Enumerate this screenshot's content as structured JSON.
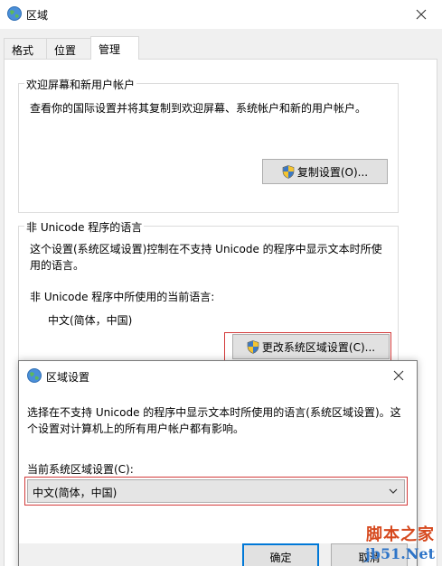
{
  "main_window": {
    "title": "区域",
    "tabs": [
      {
        "label": "格式"
      },
      {
        "label": "位置"
      },
      {
        "label": "管理"
      }
    ],
    "welcome_group": {
      "label": "欢迎屏幕和新用户帐户",
      "description": "查看你的国际设置并将其复制到欢迎屏幕、系统帐户和新的用户帐户。",
      "button_label": "复制设置(O)..."
    },
    "nonunicode_group": {
      "label": "非 Unicode 程序的语言",
      "description_line1": "这个设置(系统区域设置)控制在不支持 Unicode 的程序中显示文本时所使",
      "description_line2": "用的语言。",
      "current_label": "非 Unicode 程序中所使用的当前语言:",
      "current_value": "中文(简体，中国)",
      "button_label": "更改系统区域设置(C)..."
    }
  },
  "dialog": {
    "title": "区域设置",
    "description_line1": "选择在不支持 Unicode 的程序中显示文本时所使用的语言(系统区域设置)。这",
    "description_line2": "个设置对计算机上的所有用户帐户都有影响。",
    "select_label": "当前系统区域设置(C):",
    "select_value": "中文(简体，中国)",
    "ok_label": "确定",
    "cancel_label": "取消"
  },
  "watermark": {
    "line1": "脚本之家",
    "line2": "jb51.Net"
  },
  "colors": {
    "highlight": "#d33a3a",
    "accent": "#0078d7"
  }
}
